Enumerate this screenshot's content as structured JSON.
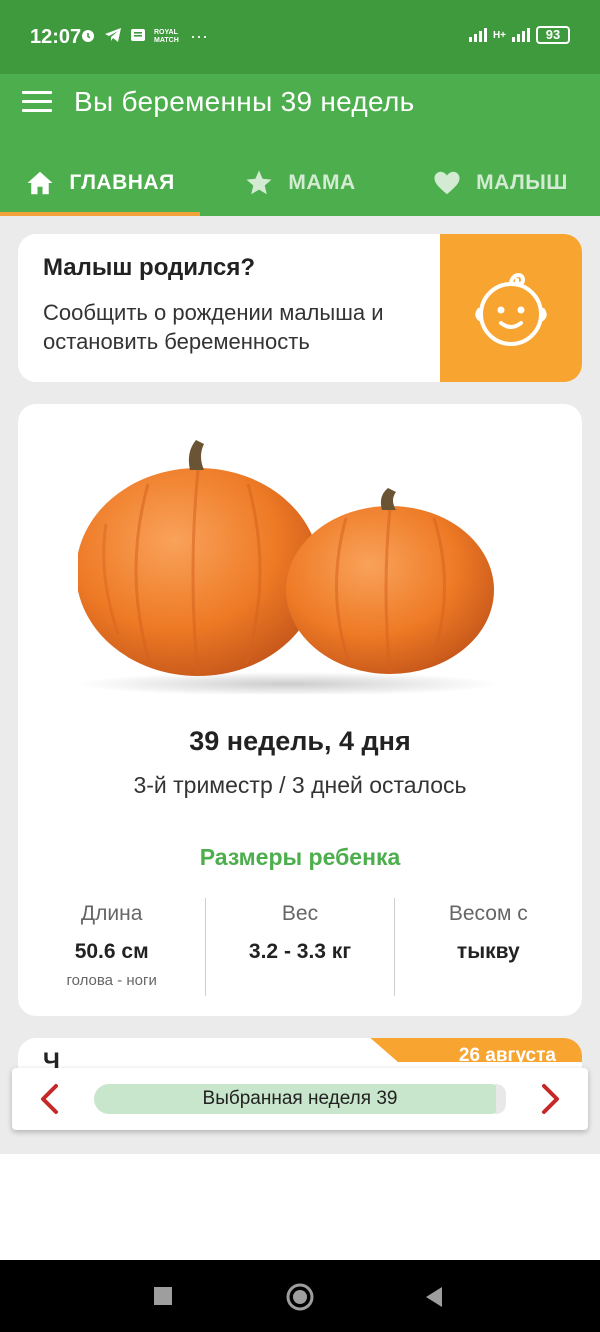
{
  "status_bar": {
    "time": "12:07",
    "royal_match": "ROYAL MATCH",
    "more": "···",
    "network": "H+",
    "battery": "93"
  },
  "app_bar": {
    "title": "Вы беременны 39 недель",
    "tabs": [
      {
        "label": "ГЛАВНАЯ",
        "icon": "home-icon",
        "active": true
      },
      {
        "label": "МАМА",
        "icon": "star-icon",
        "active": false
      },
      {
        "label": "МАЛЫШ",
        "icon": "heart-icon",
        "active": false
      }
    ]
  },
  "born_card": {
    "title": "Малыш родился?",
    "text": "Сообщить о рождении малыша и остановить беременность",
    "icon": "baby-face-icon"
  },
  "week_card": {
    "image": "pumpkin-image",
    "title": "39 недель, 4 дня",
    "subtitle": "3-й триместр / 3 дней осталось",
    "sizes_title": "Размеры ребенка",
    "sizes": [
      {
        "label": "Длина",
        "value": "50.6 см",
        "note": "голова - ноги"
      },
      {
        "label": "Вес",
        "value": "3.2 - 3.3 кг",
        "note": ""
      },
      {
        "label": "Весом с",
        "value": "тыкву",
        "note": ""
      }
    ]
  },
  "next_card": {
    "title_partial": "Ч",
    "date_tag": "26 августа"
  },
  "week_selector": {
    "label": "Выбранная неделя 39"
  },
  "colors": {
    "status_bar": "#3e9a3c",
    "app_bar": "#4cae4c",
    "accent_orange": "#f7a530",
    "tab_indicator": "#f3a23a",
    "arrow_red": "#c62828",
    "pill_green": "#c8e6cb"
  }
}
